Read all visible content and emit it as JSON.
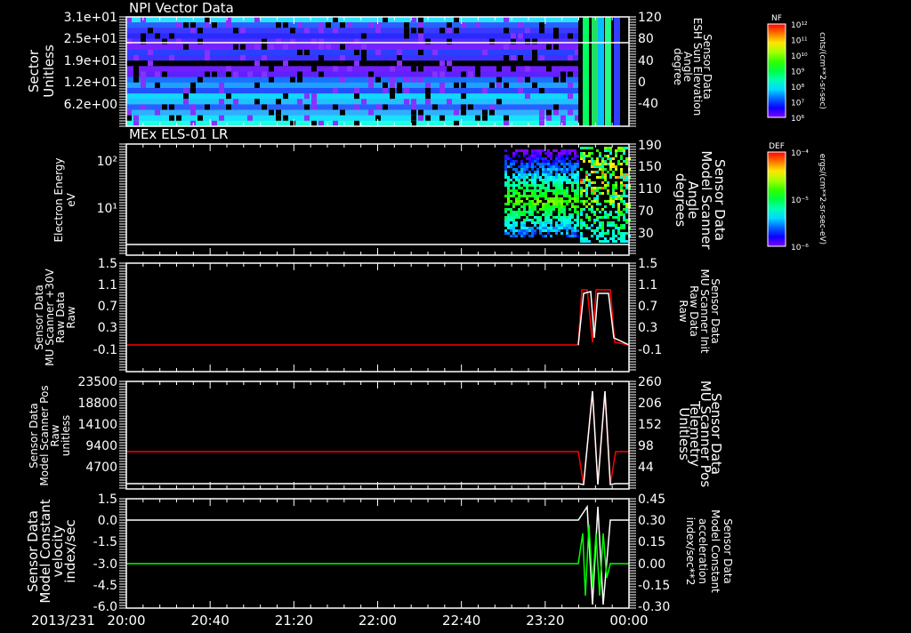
{
  "chart_data": [
    {
      "type": "heatmap",
      "title": "NPI Vector Data",
      "ylabel": [
        "Sector",
        "Unitless"
      ],
      "yticks_left": [
        "3.1e+01",
        "2.5e+01",
        "1.9e+01",
        "1.2e+01",
        "6.2e+00"
      ],
      "ylabel_right": [
        "Sensor Data",
        "ESH Sun Elevation",
        "Angle",
        "degree"
      ],
      "yticks_right": [
        "120",
        "80",
        "40",
        "0",
        "-40"
      ],
      "colorbar": {
        "label": "NF",
        "ticks": [
          "10¹²",
          "10¹¹",
          "10¹⁰",
          "10⁹",
          "10⁸",
          "10⁷",
          "10⁶"
        ],
        "units": "cnts/(cm**2-sr-sec)"
      }
    },
    {
      "type": "heatmap",
      "title": "MEx ELS-01 LR",
      "ylabel": [
        "Electron Energy",
        "eV"
      ],
      "yticks_left": [
        "10²",
        "10¹"
      ],
      "ylabel_right": [
        "Sensor Data",
        "Model Scanner",
        "Angle",
        "degrees"
      ],
      "yticks_right": [
        "190",
        "150",
        "110",
        "70",
        "30"
      ],
      "colorbar": {
        "label": "DEF",
        "ticks": [
          "10⁻⁴",
          "10⁻⁵",
          "10⁻⁶"
        ],
        "units": "ergs/(cm**2-sr-sec-eV)"
      }
    },
    {
      "type": "line",
      "ylabel": [
        "Sensor Data",
        "MU Scanner +30V",
        "Raw Data",
        "Raw"
      ],
      "yticks_left": [
        "1.5",
        "1.1",
        "0.7",
        "0.3",
        "-0.1"
      ],
      "ylabel_right": [
        "Sensor Data",
        "MU Scanner Init",
        "Raw Data",
        "Raw"
      ],
      "yticks_right": [
        "1.5",
        "1.1",
        "0.7",
        "0.3",
        "-0.1"
      ],
      "ylim": [
        -0.3,
        1.5
      ]
    },
    {
      "type": "line",
      "ylabel": [
        "Sensor Data",
        "Model Scanner Pos",
        "Raw",
        "unitless"
      ],
      "yticks_left": [
        "23500",
        "18800",
        "14100",
        "9400",
        "4700"
      ],
      "ylabel_right": [
        "Sensor Data",
        "MU Scanner Pos",
        "Telemetry",
        "Unitless"
      ],
      "yticks_right": [
        "260",
        "206",
        "152",
        "98",
        "44"
      ]
    },
    {
      "type": "line",
      "ylabel": [
        "Sensor Data",
        "Model Constant",
        "velocity",
        "index/sec"
      ],
      "yticks_left": [
        "1.5",
        "0.0",
        "-1.5",
        "-3.0",
        "-4.5",
        "-6.0"
      ],
      "ylabel_right": [
        "Sensor Data",
        "Model Constant",
        "acceleration",
        "index/sec**2"
      ],
      "yticks_right": [
        "0.45",
        "0.30",
        "0.15",
        "0.00",
        "-0.15",
        "-0.30"
      ],
      "ylim": [
        -6.0,
        1.5
      ]
    }
  ],
  "xaxis": {
    "date": "2013/231",
    "ticks": [
      "20:00",
      "20:40",
      "21:20",
      "22:00",
      "22:40",
      "23:20",
      "00:00"
    ]
  },
  "colors": {
    "red": "#ff0000",
    "green": "#00ff00",
    "white": "#ffffff"
  }
}
